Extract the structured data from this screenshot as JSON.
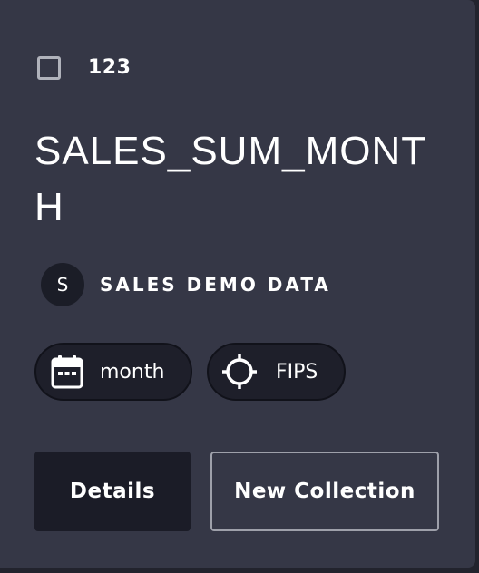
{
  "card": {
    "type_label": "123",
    "title": "SALES_SUM_MONTH",
    "source": {
      "avatar_letter": "S",
      "name": "SALES DEMO DATA"
    },
    "tags": [
      {
        "label": "month",
        "icon": "calendar-icon"
      },
      {
        "label": "FIPS",
        "icon": "crosshair-icon"
      }
    ],
    "actions": {
      "details_label": "Details",
      "new_collection_label": "New Collection"
    }
  },
  "colors": {
    "card_background": "#353746",
    "page_background": "#22232d",
    "chip_background": "#1e1f2a",
    "button_dark": "#1b1c27",
    "outline": "#9ea0aa"
  }
}
